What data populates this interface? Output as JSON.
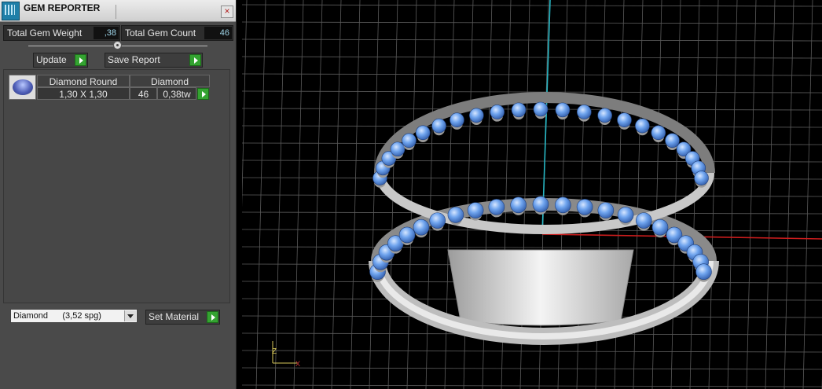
{
  "panel": {
    "title": "GEM REPORTER",
    "close_glyph": "×",
    "total_weight_label": "Total Gem Weight",
    "total_weight_value": ",38",
    "total_count_label": "Total Gem Count",
    "total_count_value": "46",
    "update_label": "Update",
    "save_report_label": "Save Report"
  },
  "gem_table": {
    "headers": [
      "Diamond Round",
      "Diamond"
    ],
    "rows": [
      {
        "size": "1,30 X 1,30",
        "count": "46",
        "weight": "0,38tw"
      }
    ]
  },
  "material": {
    "selected": "Diamond      (3,52 spg)",
    "set_label": "Set Material"
  },
  "viewport": {
    "axis_labels": {
      "z": "Z",
      "x": "X"
    },
    "colors": {
      "background": "#000000",
      "grid": "#5a5a5a",
      "axis_y": "#27b7c4",
      "axis_x": "#cc1d1d",
      "gem": "#6fa4ee",
      "metal": "#d9d9d9"
    }
  },
  "icons": {
    "app": "gem-reporter-icon",
    "close": "close-icon",
    "play": "play-arrow-icon",
    "dropdown": "chevron-down-icon",
    "gem": "round-diamond-icon"
  }
}
